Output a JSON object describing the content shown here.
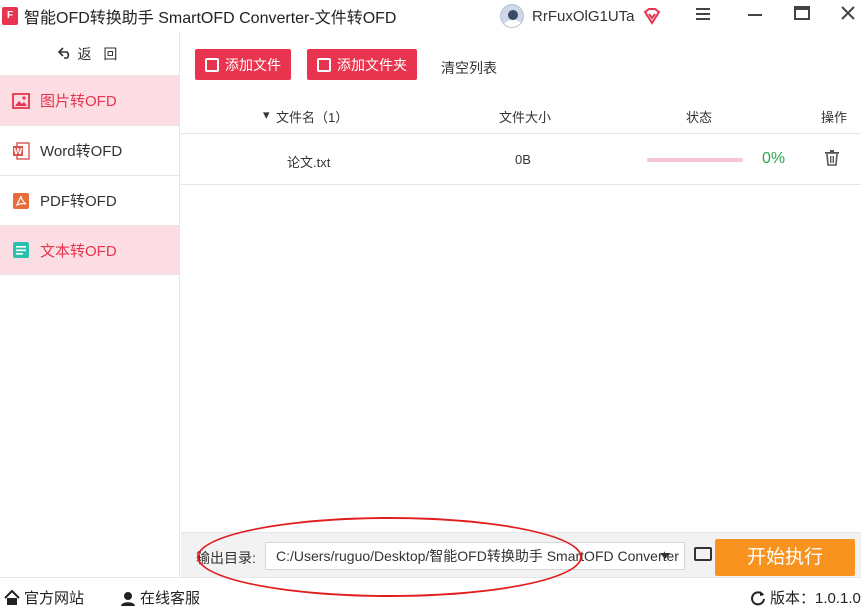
{
  "titlebar": {
    "logo_text": "F",
    "title": "智能OFD转换助手 SmartOFD Converter-文件转OFD",
    "username": "RrFuxOlG1UTa",
    "colors": {
      "brand": "#e8344e"
    }
  },
  "sidebar": {
    "back_label": "返 回",
    "items": [
      {
        "label": "图片转OFD",
        "icon": "image-icon",
        "active": true
      },
      {
        "label": "Word转OFD",
        "icon": "word-icon",
        "active": false
      },
      {
        "label": "PDF转OFD",
        "icon": "pdf-icon",
        "active": false
      },
      {
        "label": "文本转OFD",
        "icon": "text-icon",
        "active": true
      }
    ]
  },
  "toolbar": {
    "add_file": "添加文件",
    "add_folder": "添加文件夹",
    "clear_list": "清空列表"
  },
  "table": {
    "headers": {
      "name": "文件名（1）",
      "size": "文件大小",
      "status": "状态",
      "action": "操作"
    },
    "rows": [
      {
        "name": "论文.txt",
        "size": "0B",
        "progress_text": "0%",
        "progress": 0
      }
    ]
  },
  "output": {
    "label": "输出目录:",
    "path": "C:/Users/ruguo/Desktop/智能OFD转换助手 SmartOFD Converter",
    "start": "开始执行"
  },
  "statusbar": {
    "website": "官方网站",
    "support": "在线客服",
    "version": "版本：1.0.1.0"
  }
}
